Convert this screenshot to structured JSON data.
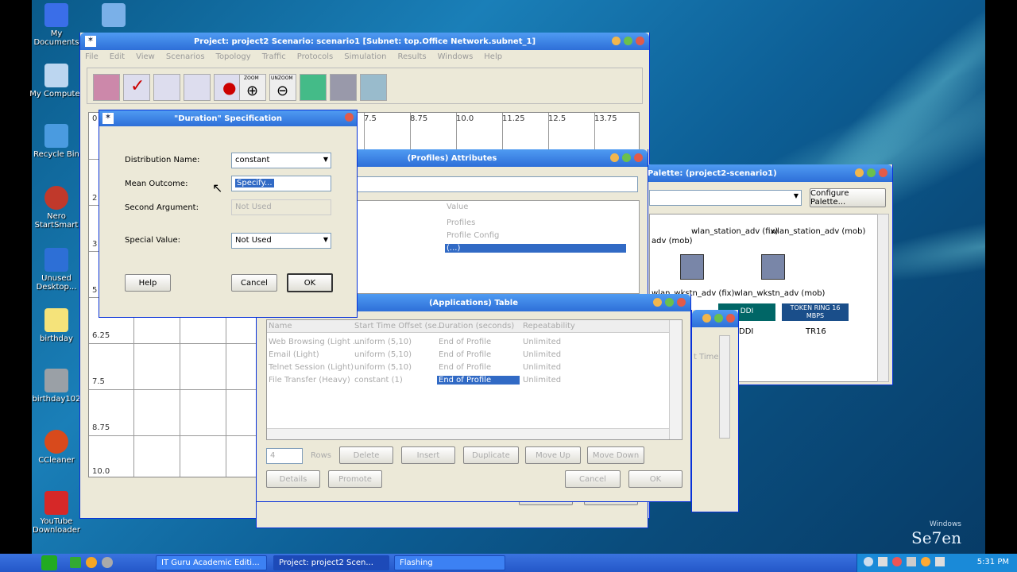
{
  "desktop": {
    "icons": [
      {
        "label": "My Documents",
        "color": "#3a6ee8"
      },
      {
        "label": "My Computer",
        "color": "#bcd6f0"
      },
      {
        "label": "Recycle Bin",
        "color": "#4a9be0"
      },
      {
        "label": "Nero StartSmart",
        "color": "#c0392b"
      },
      {
        "label": "Unused Desktop...",
        "color": "#2d6fd6"
      },
      {
        "label": "birthday",
        "color": "#f5e37a"
      },
      {
        "label": "birthday102",
        "color": "#9aa0a6"
      },
      {
        "label": "CCleaner",
        "color": "#d84a1c"
      },
      {
        "label": "YouTube Downloader",
        "color": "#d62828"
      }
    ],
    "icon2_label": "",
    "logo_top": "Windows",
    "logo_main": "Se7en"
  },
  "main_window": {
    "title": "Project: project2 Scenario: scenario1  [Subnet: top.Office Network.subnet_1]",
    "menu": [
      "File",
      "Edit",
      "View",
      "Scenarios",
      "Topology",
      "Traffic",
      "Protocols",
      "Simulation",
      "Results",
      "Windows",
      "Help"
    ],
    "toolbar": [
      "open-palette",
      "check-links",
      "fail-node",
      "recover-node",
      "return-parent",
      "zoom",
      "unzoom",
      "configure-simulation",
      "view-results",
      "hide-graphs"
    ],
    "toolbar_text": {
      "zoom": "ZOOM",
      "unzoom": "UNZOOM"
    },
    "x_ticks": [
      "0",
      "7.5",
      "8.75",
      "10.0",
      "11.25",
      "12.5",
      "13.75"
    ],
    "y_ticks": [
      "2",
      "3",
      "5",
      "6.25",
      "7.5",
      "8.75",
      "10.0"
    ]
  },
  "duration": {
    "title": "\"Duration\" Specification",
    "dist_label": "Distribution Name:",
    "dist_value": "constant",
    "mean_label": "Mean Outcome:",
    "mean_value": "Specify...",
    "second_label": "Second Argument:",
    "second_value": "Not Used",
    "special_label": "Special Value:",
    "special_value": "Not Used",
    "help": "Help",
    "cancel": "Cancel",
    "ok": "OK"
  },
  "profiles": {
    "title": "(Profiles) Attributes",
    "col_value": "Value",
    "rows": [
      "Profiles",
      "Profile Config",
      "(...)"
    ]
  },
  "palette": {
    "title": "Palette: (project2-scenario1)",
    "configure": "Configure Palette...",
    "items": [
      "adv (mob)",
      "wlan_station_adv (fix)",
      "wlan_station_adv (mob)",
      "wlan_wkstn_adv (fix)",
      "wlan_wkstn_adv (mob)",
      "DDI",
      "TR16"
    ],
    "token_ring": "TOKEN RING 16 MBPS",
    "fddi": "DDI"
  },
  "apps": {
    "title": "(Applications) Table",
    "headers": [
      "Name",
      "Start Time Offset (se...",
      "Duration (seconds)",
      "Repeatability"
    ],
    "rows": [
      [
        "Web Browsing (Light ...",
        "uniform (5,10)",
        "End of Profile",
        "Unlimited"
      ],
      [
        "Email (Light)",
        "uniform (5,10)",
        "End of Profile",
        "Unlimited"
      ],
      [
        "Telnet Session (Light)",
        "uniform (5,10)",
        "End of Profile",
        "Unlimited"
      ],
      [
        "File Transfer (Heavy)",
        "constant (1)",
        "End of Profile",
        "Unlimited"
      ]
    ],
    "rows_count": "4",
    "rows_label": "Rows",
    "buttons": [
      "Delete",
      "Insert",
      "Duplicate",
      "Move Up",
      "Move Down"
    ],
    "details": "Details",
    "promote": "Promote",
    "cancel": "Cancel",
    "ok": "OK",
    "time_label": "t Time"
  },
  "taskbar": {
    "items": [
      "IT Guru Academic Editi...",
      "Project: project2 Scen...",
      "Flashing"
    ],
    "clock": "5:31 PM"
  }
}
